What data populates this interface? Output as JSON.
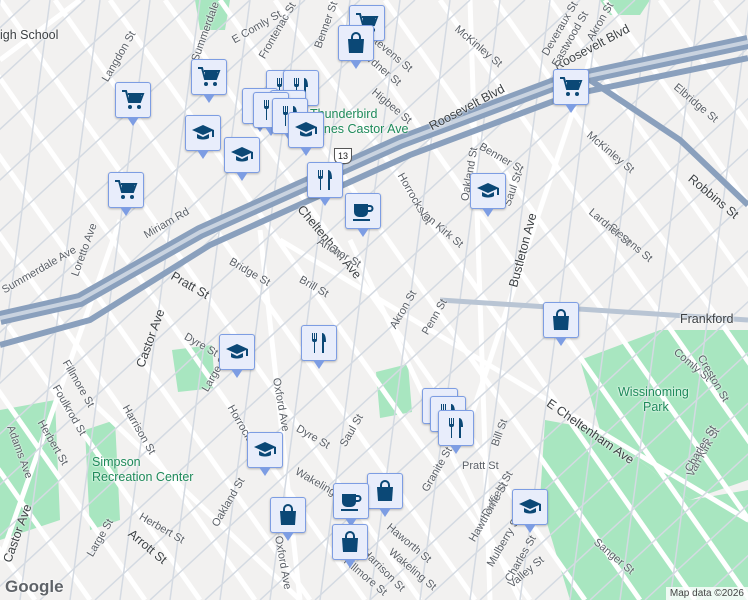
{
  "colors": {
    "background": "#f2f1f0",
    "street": "#ffffff",
    "street_edge": "#d4dae2",
    "highway": "#8aa0bd",
    "park": "#a8e6c0",
    "marker_fill": "#e8edfb",
    "marker_border": "#7d9de3",
    "marker_icon": "#0b4876"
  },
  "labels": [
    "Roosevelt Blvd",
    "Roosevelt Blvd",
    "Thunderbird",
    "Lanes Castor Ave",
    "Wissinoming",
    "Park",
    "Simpson",
    "Recreation Center",
    "Frankford",
    "Robbins St",
    "Bustleton Ave",
    "Castor Ave",
    "Castor Ave",
    "Oxford Ave",
    "Oxford Ave",
    "Pratt St",
    "Pratt St",
    "E Cheltenham Ave",
    "Cheltenham Ave",
    "Adams Ave",
    "Summerdale Ave",
    "Langdon St",
    "Summerdale",
    "Loretto Ave",
    "Miriam Rd",
    "Bridge St",
    "Brill St",
    "Anchor St",
    "Akron St",
    "Penn St",
    "Dyre St",
    "Dyre St",
    "Large St",
    "Harrison St",
    "Harrison St",
    "Herbert St",
    "Herbert St",
    "Foulkrod St",
    "Fillmore St",
    "Fillmore St",
    "Horrocks St",
    "Horrocks St",
    "Saul St",
    "Saul St",
    "Oakland St",
    "Oakland St",
    "Van Kirk St",
    "Van Kirk St",
    "Benner St",
    "Benner St",
    "McKinley St",
    "McKinley St",
    "Stevens St",
    "Stevens St",
    "Lardner St",
    "Lardner St",
    "Higbee St",
    "E Comly St",
    "Comly St",
    "Eastwood St",
    "Akron St",
    "Elbridge St",
    "Arrott St",
    "Wakeling St",
    "Wakeling St",
    "Haworth St",
    "Granite St",
    "Duffield St",
    "Hawthorne St",
    "Mulberry St",
    "Charles St",
    "Charles St",
    "Valley St",
    "Sanger St",
    "Bill St",
    "Creston St",
    "Large St",
    "igh School",
    "Frontenac St",
    "Deveraux St"
  ],
  "markers": [
    "cart",
    "bag",
    "cart",
    "cart",
    "cart",
    "school",
    "school",
    "restaurant",
    "restaurant",
    "restaurant",
    "school",
    "restaurant",
    "restaurant",
    "school",
    "restaurant",
    "coffee",
    "school",
    "cart",
    "bag",
    "restaurant",
    "school",
    "school",
    "restaurant",
    "restaurant",
    "restaurant",
    "bag",
    "coffee",
    "bag",
    "bag",
    "school"
  ],
  "route_shield": "13",
  "logo": "Google",
  "attribution": "Map data ©2026"
}
